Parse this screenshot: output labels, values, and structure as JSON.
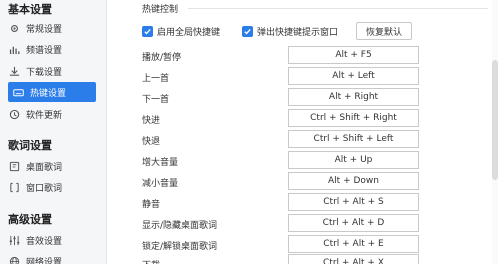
{
  "sidebar": {
    "groups": [
      {
        "title": "基本设置"
      },
      {
        "title": "歌词设置"
      },
      {
        "title": "高级设置"
      }
    ],
    "items": [
      {
        "label": "常规设置",
        "icon": "gear-icon"
      },
      {
        "label": "频谱设置",
        "icon": "spectrum-icon"
      },
      {
        "label": "下载设置",
        "icon": "download-icon"
      },
      {
        "label": "热键设置",
        "icon": "keyboard-icon"
      },
      {
        "label": "软件更新",
        "icon": "update-icon"
      },
      {
        "label": "桌面歌词",
        "icon": "desktop-lyrics-icon"
      },
      {
        "label": "窗口歌词",
        "icon": "window-lyrics-icon"
      },
      {
        "label": "音效设置",
        "icon": "equalizer-icon"
      },
      {
        "label": "网络设置",
        "icon": "network-icon"
      }
    ],
    "active_index": 3
  },
  "hotkeys": {
    "section_title": "热键控制",
    "enable_global_label": "启用全局快捷键",
    "enable_global_checked": true,
    "popup_label": "弹出快捷键提示窗口",
    "popup_checked": true,
    "restore_label": "恢复默认",
    "rows": [
      {
        "label": "播放/暂停",
        "key": "Alt + F5"
      },
      {
        "label": "上一首",
        "key": "Alt + Left"
      },
      {
        "label": "下一首",
        "key": "Alt + Right"
      },
      {
        "label": "快进",
        "key": "Ctrl + Shift + Right"
      },
      {
        "label": "快退",
        "key": "Ctrl + Shift + Left"
      },
      {
        "label": "增大音量",
        "key": "Alt + Up"
      },
      {
        "label": "减小音量",
        "key": "Alt + Down"
      },
      {
        "label": "静音",
        "key": "Ctrl + Alt + S"
      },
      {
        "label": "显示/隐藏桌面歌词",
        "key": "Ctrl + Alt + D"
      },
      {
        "label": "锁定/解锁桌面歌词",
        "key": "Ctrl + Alt + E"
      },
      {
        "label": "下载",
        "key": "Ctrl + Alt + X"
      }
    ]
  },
  "colors": {
    "accent": "#2b7de9",
    "sidebar_bg": "#f4f6f8"
  }
}
